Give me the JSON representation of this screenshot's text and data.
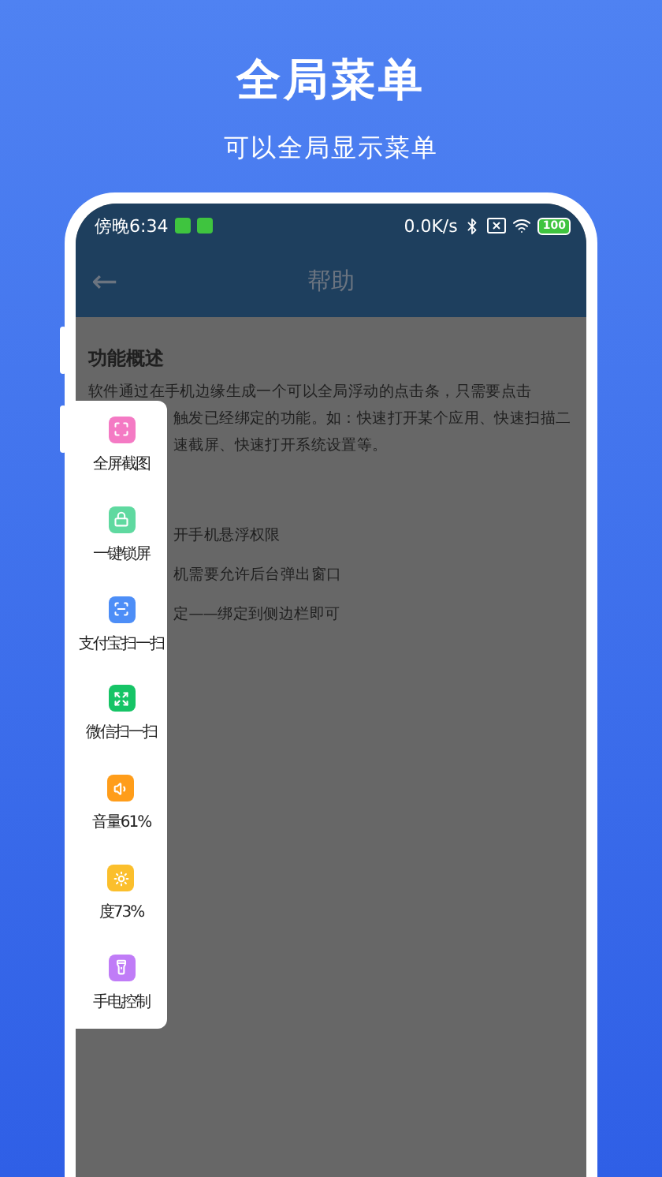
{
  "header": {
    "title": "全局菜单",
    "subtitle": "可以全局显示菜单"
  },
  "status_bar": {
    "time": "傍晚6:34",
    "speed": "0.0K/s",
    "battery": "100"
  },
  "app_bar": {
    "back": "←",
    "title": "帮助"
  },
  "content": {
    "heading": "功能概述",
    "paragraph_lines": [
      "软件通过在手机边缘生成一个可以全局浮动的点击条，只需要点击",
      "触发已经绑定的功能。如：快速打开某个应用、快速扫描二",
      "速截屏、快速打开系统设置等。"
    ],
    "steps": [
      "开手机悬浮权限",
      "机需要允许后台弹出窗口",
      "定——绑定到侧边栏即可"
    ]
  },
  "float_menu": [
    {
      "label": "全屏截图",
      "kind": "screenshot",
      "color": "#f47ac4"
    },
    {
      "label": "一键锁屏",
      "kind": "lock",
      "color": "#5fd9a0"
    },
    {
      "label": "支付宝扫一扫",
      "kind": "scan",
      "color": "#4d8ef7"
    },
    {
      "label": "微信扫一扫",
      "kind": "expand",
      "color": "#16c466"
    },
    {
      "label": "音量61%",
      "kind": "volume",
      "color": "#ff9d1a"
    },
    {
      "label": "度73%",
      "kind": "brightness",
      "color": "#fbbf2c"
    },
    {
      "label": "手电控制",
      "kind": "flashlight",
      "color": "#c07cf7"
    }
  ]
}
